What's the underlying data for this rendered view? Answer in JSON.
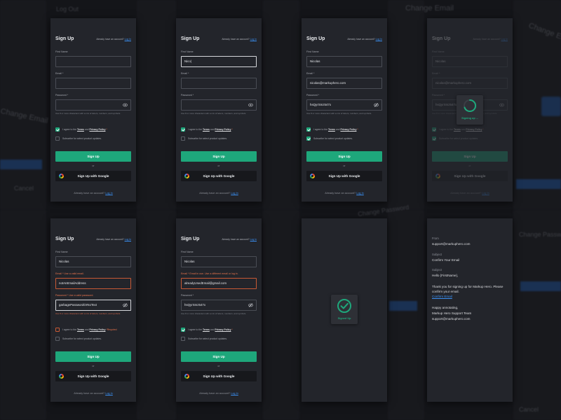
{
  "background": {
    "texts": [
      "Log Out",
      "Cancel",
      "Change Email",
      "Change Email",
      "Change Email",
      "Cancel",
      "Change Password",
      "Change Password"
    ]
  },
  "cards": [
    {
      "title": "Sign Up",
      "have_account": "Already have an account?",
      "have_link": "Log In",
      "first_name_label": "First Name",
      "first_name_value": "",
      "email_label": "Email *",
      "email_value": "",
      "password_label": "Password *",
      "password_value": "",
      "password_hint": "Use 8 or more characters with a mix of letters, numbers, and symbols.",
      "terms_pre": "I agree to the",
      "terms": "Terms",
      "and": "and",
      "privacy": "Privacy Policy",
      "terms_req": "*",
      "subscribe": "Subscribe for select product updates.",
      "signup_button": "Sign Up",
      "or": "or",
      "google_button": "Sign Up with Google",
      "footer": "Already have an account?",
      "footer_link": "Log In"
    },
    {
      "title": "Sign Up",
      "have_account": "Already have an account?",
      "have_link": "Log In",
      "first_name_label": "First Name",
      "first_name_value": "Nico|",
      "email_label": "Email *",
      "email_value": "",
      "password_label": "Password *",
      "password_value": "",
      "password_hint": "Use 8 or more characters with a mix of letters, numbers, and symbols.",
      "terms_pre": "I agree to the",
      "terms": "Terms",
      "and": "and",
      "privacy": "Privacy Policy",
      "terms_req": "*",
      "subscribe": "Subscribe for select product updates.",
      "signup_button": "Sign Up",
      "or": "or",
      "google_button": "Sign Up with Google",
      "footer": "Already have an account?",
      "footer_link": "Log In"
    },
    {
      "title": "Sign Up",
      "have_account": "Already have an account?",
      "have_link": "Log In",
      "first_name_label": "First Name",
      "first_name_value": "Nicolas",
      "email_label": "Email *",
      "email_value": "nicolas@markuphero.com",
      "password_label": "Password *",
      "password_value": "hsQyrSmz547x",
      "password_hint": "Use 8 or more characters with a mix of letters, numbers, and symbols.",
      "terms_pre": "I agree to the",
      "terms": "Terms",
      "and": "and",
      "privacy": "Privacy Policy",
      "terms_req": "*",
      "subscribe": "Subscribe for select product updates.",
      "signup_button": "Sign Up",
      "or": "or",
      "google_button": "Sign Up with Google",
      "footer": "Already have an account?",
      "footer_link": "Log In"
    },
    {
      "title": "Sign Up",
      "have_account": "Already have an account?",
      "have_link": "Log In",
      "first_name_label": "First Name",
      "first_name_value": "Nicolas",
      "email_label": "Email *",
      "email_value": "nicolas@markuphero.com",
      "password_label": "Password *",
      "password_value": "hsQyrSmz547x",
      "password_hint": "Use 8 or more characters with a mix of letters, numbers, and symbols.",
      "terms_pre": "I agree to the",
      "terms": "Terms",
      "and": "and",
      "privacy": "Privacy Policy",
      "terms_req": "*",
      "subscribe": "Subscribe for select product updates.",
      "signup_button": "Sign Up",
      "or": "or",
      "google_button": "Sign Up with Google",
      "footer": "Already have an account?",
      "footer_link": "Log In",
      "overlay_label": "Signing up ..."
    },
    {
      "title": "Sign Up",
      "have_account": "Already have an account?",
      "have_link": "Log In",
      "first_name_label": "First Name",
      "first_name_value": "Nicolas",
      "email_label": "Email *",
      "email_error": "Use a valid email.",
      "email_value": "notAnEmailAddress",
      "password_label": "Password *",
      "password_error": "Use a valid password.",
      "password_value": "garbagePasswordOrNoText",
      "password_hint": "Use 8 or more characters with a mix of letters, numbers, and symbols.",
      "terms_pre": "I agree to the",
      "terms": "Terms",
      "and": "and",
      "privacy": "Privacy Policy",
      "terms_req": "*Required",
      "subscribe": "Subscribe for select product updates.",
      "signup_button": "Sign Up",
      "or": "or",
      "google_button": "Sign Up with Google",
      "footer": "Already have an account?",
      "footer_link": "Log In"
    },
    {
      "title": "Sign Up",
      "have_account": "Already have an account?",
      "have_link": "Log In",
      "first_name_label": "First Name",
      "first_name_value": "Nicolas",
      "email_label": "Email *",
      "email_error": "Email in use. Use a different email or log in.",
      "email_value": "alreadyUsedEmail@gmail.com",
      "password_label": "Password *",
      "password_value": "hsQyrSmz547x",
      "password_hint": "Use 8 or more characters with a mix of letters, numbers, and symbols.",
      "terms_pre": "I agree to the",
      "terms": "Terms",
      "and": "and",
      "privacy": "Privacy Policy",
      "terms_req": "*",
      "subscribe": "Subscribe for select product updates.",
      "signup_button": "Sign Up",
      "or": "or",
      "google_button": "Sign Up with Google",
      "footer": "Already have an account?",
      "footer_link": "Log In"
    }
  ],
  "signed_up": {
    "label": "Signed Up"
  },
  "email": {
    "from_label": "From",
    "from_value": "support@markuphero.com",
    "subject_label": "Subject",
    "subject_value": "Confirm Your Email",
    "body_label": "Subject",
    "greeting": "Hello {FirstName},",
    "body1": "Thank you for signing up for Markup Hero. Please confirm your email.",
    "confirm_link": "Confirm Email",
    "signoff": "Happy annotating,",
    "team": "Markup Hero Support Team",
    "team_email": "support@markuphero.com"
  },
  "colors": {
    "accent": "#1ea77b",
    "link": "#3a8ff2",
    "error": "#e8744d",
    "card": "#23252b",
    "bg": "#141519"
  }
}
